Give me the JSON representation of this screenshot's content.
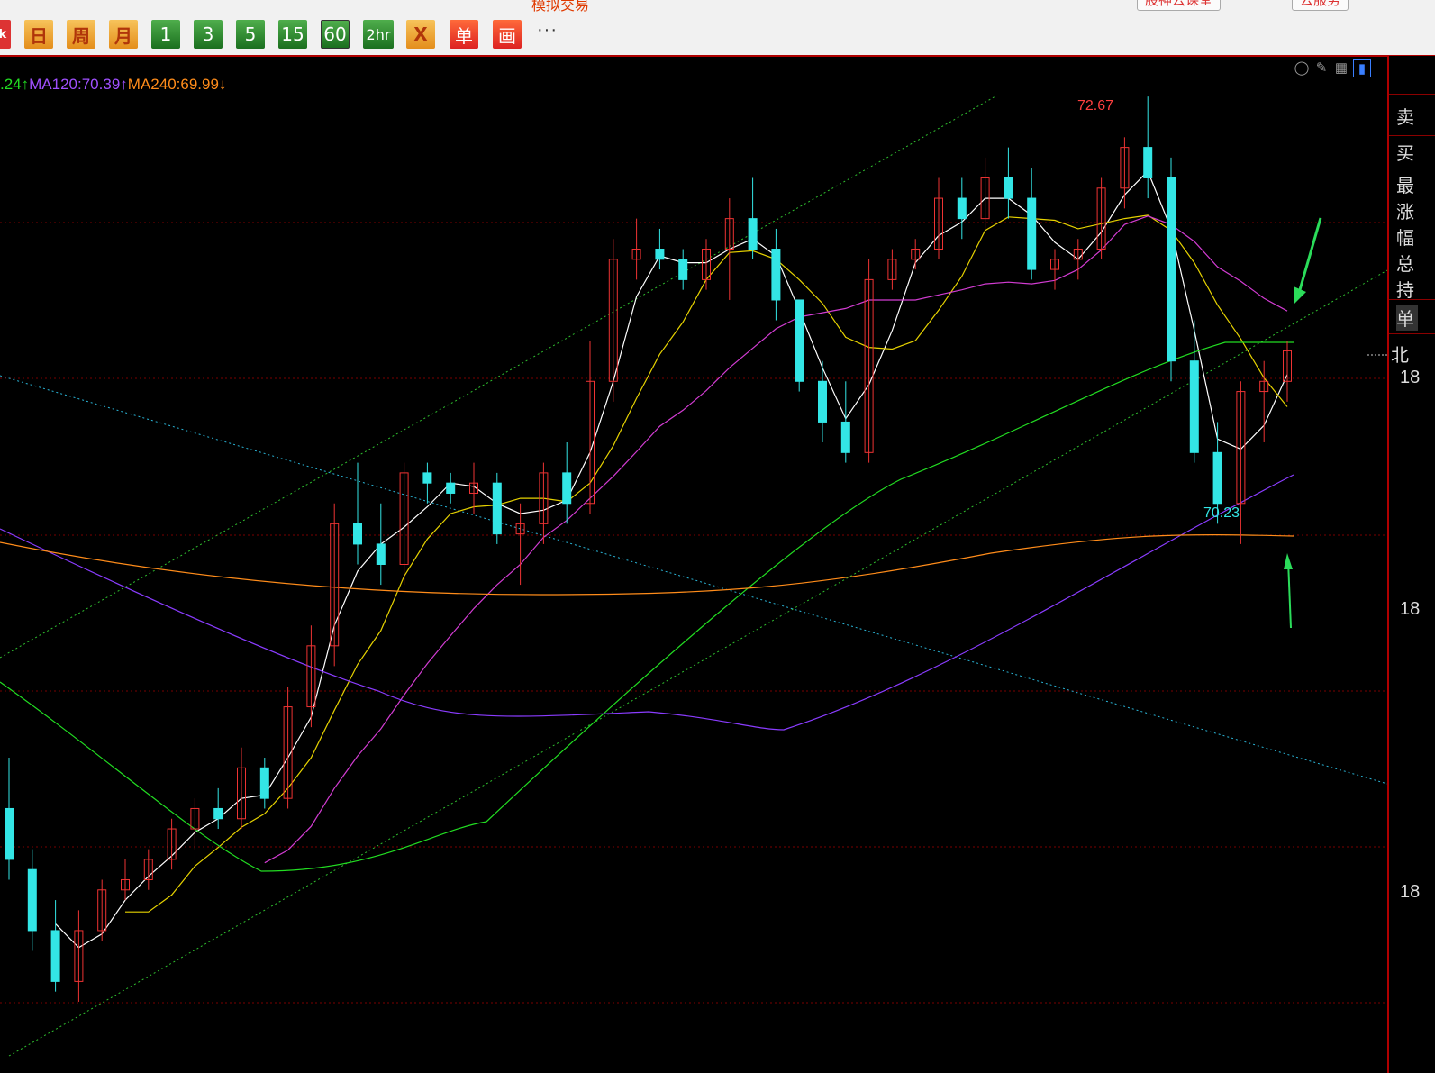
{
  "window": {
    "title_fragment": "模拟交易"
  },
  "top_right_buttons": [
    {
      "label": "股神云课堂"
    },
    {
      "label": "云服务"
    }
  ],
  "toolbar": {
    "cut_label": "ck",
    "buttons": [
      {
        "label": "日",
        "style": "orange"
      },
      {
        "label": "周",
        "style": "orange"
      },
      {
        "label": "月",
        "style": "orange"
      },
      {
        "label": "1",
        "style": "green"
      },
      {
        "label": "3",
        "style": "green"
      },
      {
        "label": "5",
        "style": "green"
      },
      {
        "label": "15",
        "style": "green"
      },
      {
        "label": "60",
        "style": "green",
        "selected": true
      },
      {
        "label": "2hr",
        "style": "green"
      },
      {
        "label": "X",
        "style": "orange"
      },
      {
        "label": "单",
        "style": "red"
      },
      {
        "label": "画",
        "style": "red"
      }
    ],
    "more_label": "···"
  },
  "ma_legend": [
    {
      "text": ".24↑",
      "color": "#22dd22"
    },
    {
      "text": "MA120:70.39↑",
      "color": "#a050ff"
    },
    {
      "text": "MA240:69.99↓",
      "color": "#ff8c1a"
    }
  ],
  "chart_icons": [
    "eye-hide-icon",
    "pencil-icon",
    "grid-icon",
    "panel-toggle-icon"
  ],
  "annotations": {
    "high_label": "72.67",
    "low_label": "70.23"
  },
  "right_panel": {
    "items": [
      "卖",
      "买",
      "最",
      "涨",
      "幅",
      "总",
      "持",
      "单",
      "北"
    ],
    "price_ticks": [
      "18",
      "18",
      "18"
    ]
  },
  "colors": {
    "up": "#ee3333",
    "down": "#33e6e6",
    "background": "#000000",
    "grid": "#7a0000"
  },
  "chart_data": {
    "type": "candlestick",
    "timeframe": "60",
    "highest_marked": 72.67,
    "lowest_marked": 70.23,
    "moving_averages": [
      {
        "name": "MA120",
        "value": 70.39,
        "direction": "up"
      },
      {
        "name": "MA240",
        "value": 69.99,
        "direction": "down"
      }
    ],
    "candles_ohlc": [
      [
        69.2,
        69.45,
        68.85,
        68.95
      ],
      [
        68.9,
        69.0,
        68.5,
        68.6
      ],
      [
        68.6,
        68.75,
        68.3,
        68.35
      ],
      [
        68.35,
        68.7,
        68.25,
        68.6
      ],
      [
        68.6,
        68.85,
        68.55,
        68.8
      ],
      [
        68.8,
        68.95,
        68.75,
        68.85
      ],
      [
        68.85,
        69.0,
        68.8,
        68.95
      ],
      [
        68.95,
        69.15,
        68.9,
        69.1
      ],
      [
        69.1,
        69.25,
        69.0,
        69.2
      ],
      [
        69.2,
        69.3,
        69.1,
        69.15
      ],
      [
        69.15,
        69.5,
        69.1,
        69.4
      ],
      [
        69.4,
        69.45,
        69.2,
        69.25
      ],
      [
        69.25,
        69.8,
        69.2,
        69.7
      ],
      [
        69.7,
        70.1,
        69.6,
        70.0
      ],
      [
        70.0,
        70.7,
        69.9,
        70.6
      ],
      [
        70.6,
        70.9,
        70.4,
        70.5
      ],
      [
        70.5,
        70.7,
        70.3,
        70.4
      ],
      [
        70.4,
        70.9,
        70.3,
        70.85
      ],
      [
        70.85,
        70.9,
        70.7,
        70.8
      ],
      [
        70.8,
        70.85,
        70.7,
        70.75
      ],
      [
        70.75,
        70.9,
        70.65,
        70.8
      ],
      [
        70.8,
        70.85,
        70.5,
        70.55
      ],
      [
        70.55,
        70.7,
        70.3,
        70.6
      ],
      [
        70.6,
        70.9,
        70.5,
        70.85
      ],
      [
        70.85,
        71.0,
        70.6,
        70.7
      ],
      [
        70.7,
        71.5,
        70.65,
        71.3
      ],
      [
        71.3,
        72.0,
        71.2,
        71.9
      ],
      [
        71.9,
        72.1,
        71.8,
        71.95
      ],
      [
        71.95,
        72.05,
        71.85,
        71.9
      ],
      [
        71.9,
        71.95,
        71.75,
        71.8
      ],
      [
        71.8,
        72.0,
        71.75,
        71.95
      ],
      [
        71.95,
        72.2,
        71.7,
        72.1
      ],
      [
        72.1,
        72.3,
        71.9,
        71.95
      ],
      [
        71.95,
        72.05,
        71.6,
        71.7
      ],
      [
        71.7,
        71.6,
        71.25,
        71.3
      ],
      [
        71.3,
        71.4,
        71.0,
        71.1
      ],
      [
        71.1,
        71.3,
        70.9,
        70.95
      ],
      [
        70.95,
        71.9,
        70.9,
        71.8
      ],
      [
        71.8,
        71.95,
        71.75,
        71.9
      ],
      [
        71.9,
        72.0,
        71.85,
        71.95
      ],
      [
        71.95,
        72.3,
        71.9,
        72.2
      ],
      [
        72.2,
        72.3,
        72.0,
        72.1
      ],
      [
        72.1,
        72.4,
        72.05,
        72.3
      ],
      [
        72.3,
        72.45,
        72.1,
        72.2
      ],
      [
        72.2,
        72.35,
        71.8,
        71.85
      ],
      [
        71.85,
        71.95,
        71.75,
        71.9
      ],
      [
        71.9,
        72.0,
        71.8,
        71.95
      ],
      [
        71.95,
        72.3,
        71.9,
        72.25
      ],
      [
        72.25,
        72.5,
        72.15,
        72.45
      ],
      [
        72.45,
        72.7,
        72.2,
        72.3
      ],
      [
        72.3,
        72.4,
        71.3,
        71.4
      ],
      [
        71.4,
        71.6,
        70.9,
        70.95
      ],
      [
        70.95,
        71.1,
        70.6,
        70.7
      ],
      [
        70.7,
        71.3,
        70.5,
        71.25
      ],
      [
        71.25,
        71.4,
        71.0,
        71.3
      ],
      [
        71.3,
        71.5,
        71.2,
        71.45
      ]
    ]
  }
}
